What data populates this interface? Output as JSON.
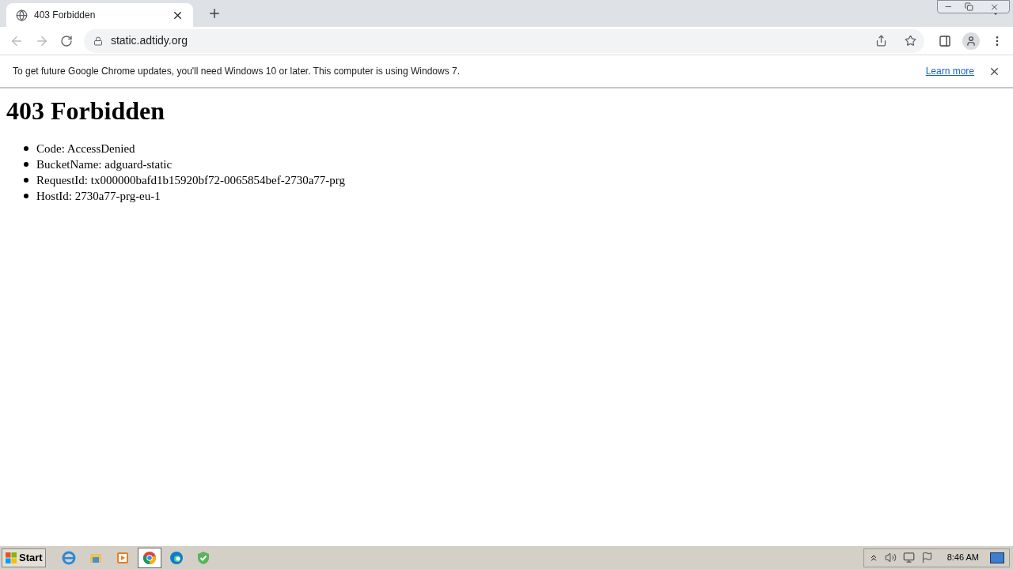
{
  "tab": {
    "title": "403 Forbidden",
    "selected": true
  },
  "address": "static.adtidy.org",
  "infobar": {
    "message": "To get future Google Chrome updates, you'll need Windows 10 or later. This computer is using Windows 7.",
    "link": "Learn more"
  },
  "page": {
    "heading": "403 Forbidden",
    "items": [
      "Code: AccessDenied",
      "BucketName: adguard-static",
      "RequestId: tx000000bafd1b15920bf72-0065854bef-2730a77-prg",
      "HostId: 2730a77-prg-eu-1"
    ]
  },
  "taskbar": {
    "start": "Start",
    "apps": [
      {
        "kind": "ie",
        "selected": false
      },
      {
        "kind": "explorer",
        "selected": false
      },
      {
        "kind": "media",
        "selected": false
      },
      {
        "kind": "chrome",
        "selected": true
      },
      {
        "kind": "edge",
        "selected": false
      },
      {
        "kind": "shield",
        "selected": false
      }
    ],
    "clock": "8:46 AM"
  }
}
